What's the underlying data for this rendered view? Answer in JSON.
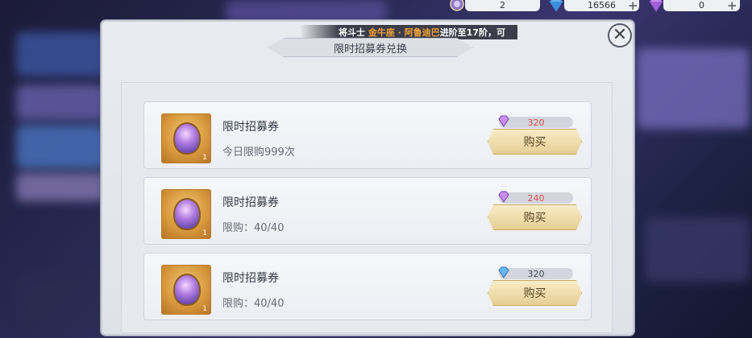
{
  "resources": [
    {
      "icon": "ticket-icon",
      "value": "2"
    },
    {
      "icon": "diamond-icon",
      "value": "16566"
    },
    {
      "icon": "crystal-icon",
      "value": "0"
    }
  ],
  "dialog": {
    "notice_prefix": "将斗士",
    "notice_highlight": "金牛座 · 阿鲁迪巴",
    "notice_suffix": "进阶至17阶，可",
    "title": "限时招募券兑换",
    "close_symbol": "✕"
  },
  "items": [
    {
      "name": "限时招募券",
      "limit": "今日限购999次",
      "price": "320",
      "price_color": "red",
      "currency_icon": "purple-gem-icon",
      "qty": "1",
      "buy_label": "购买"
    },
    {
      "name": "限时招募券",
      "limit": "限购：40/40",
      "price": "240",
      "price_color": "red",
      "currency_icon": "purple-gem-icon",
      "qty": "1",
      "buy_label": "购买"
    },
    {
      "name": "限时招募券",
      "limit": "限购：40/40",
      "price": "320",
      "price_color": "dark",
      "currency_icon": "blue-diamond-icon",
      "qty": "1",
      "buy_label": "购买"
    }
  ],
  "colors": {
    "price_red": "#e0514b",
    "notice_highlight": "#f2a233",
    "button_gold": "#e6cf94"
  }
}
